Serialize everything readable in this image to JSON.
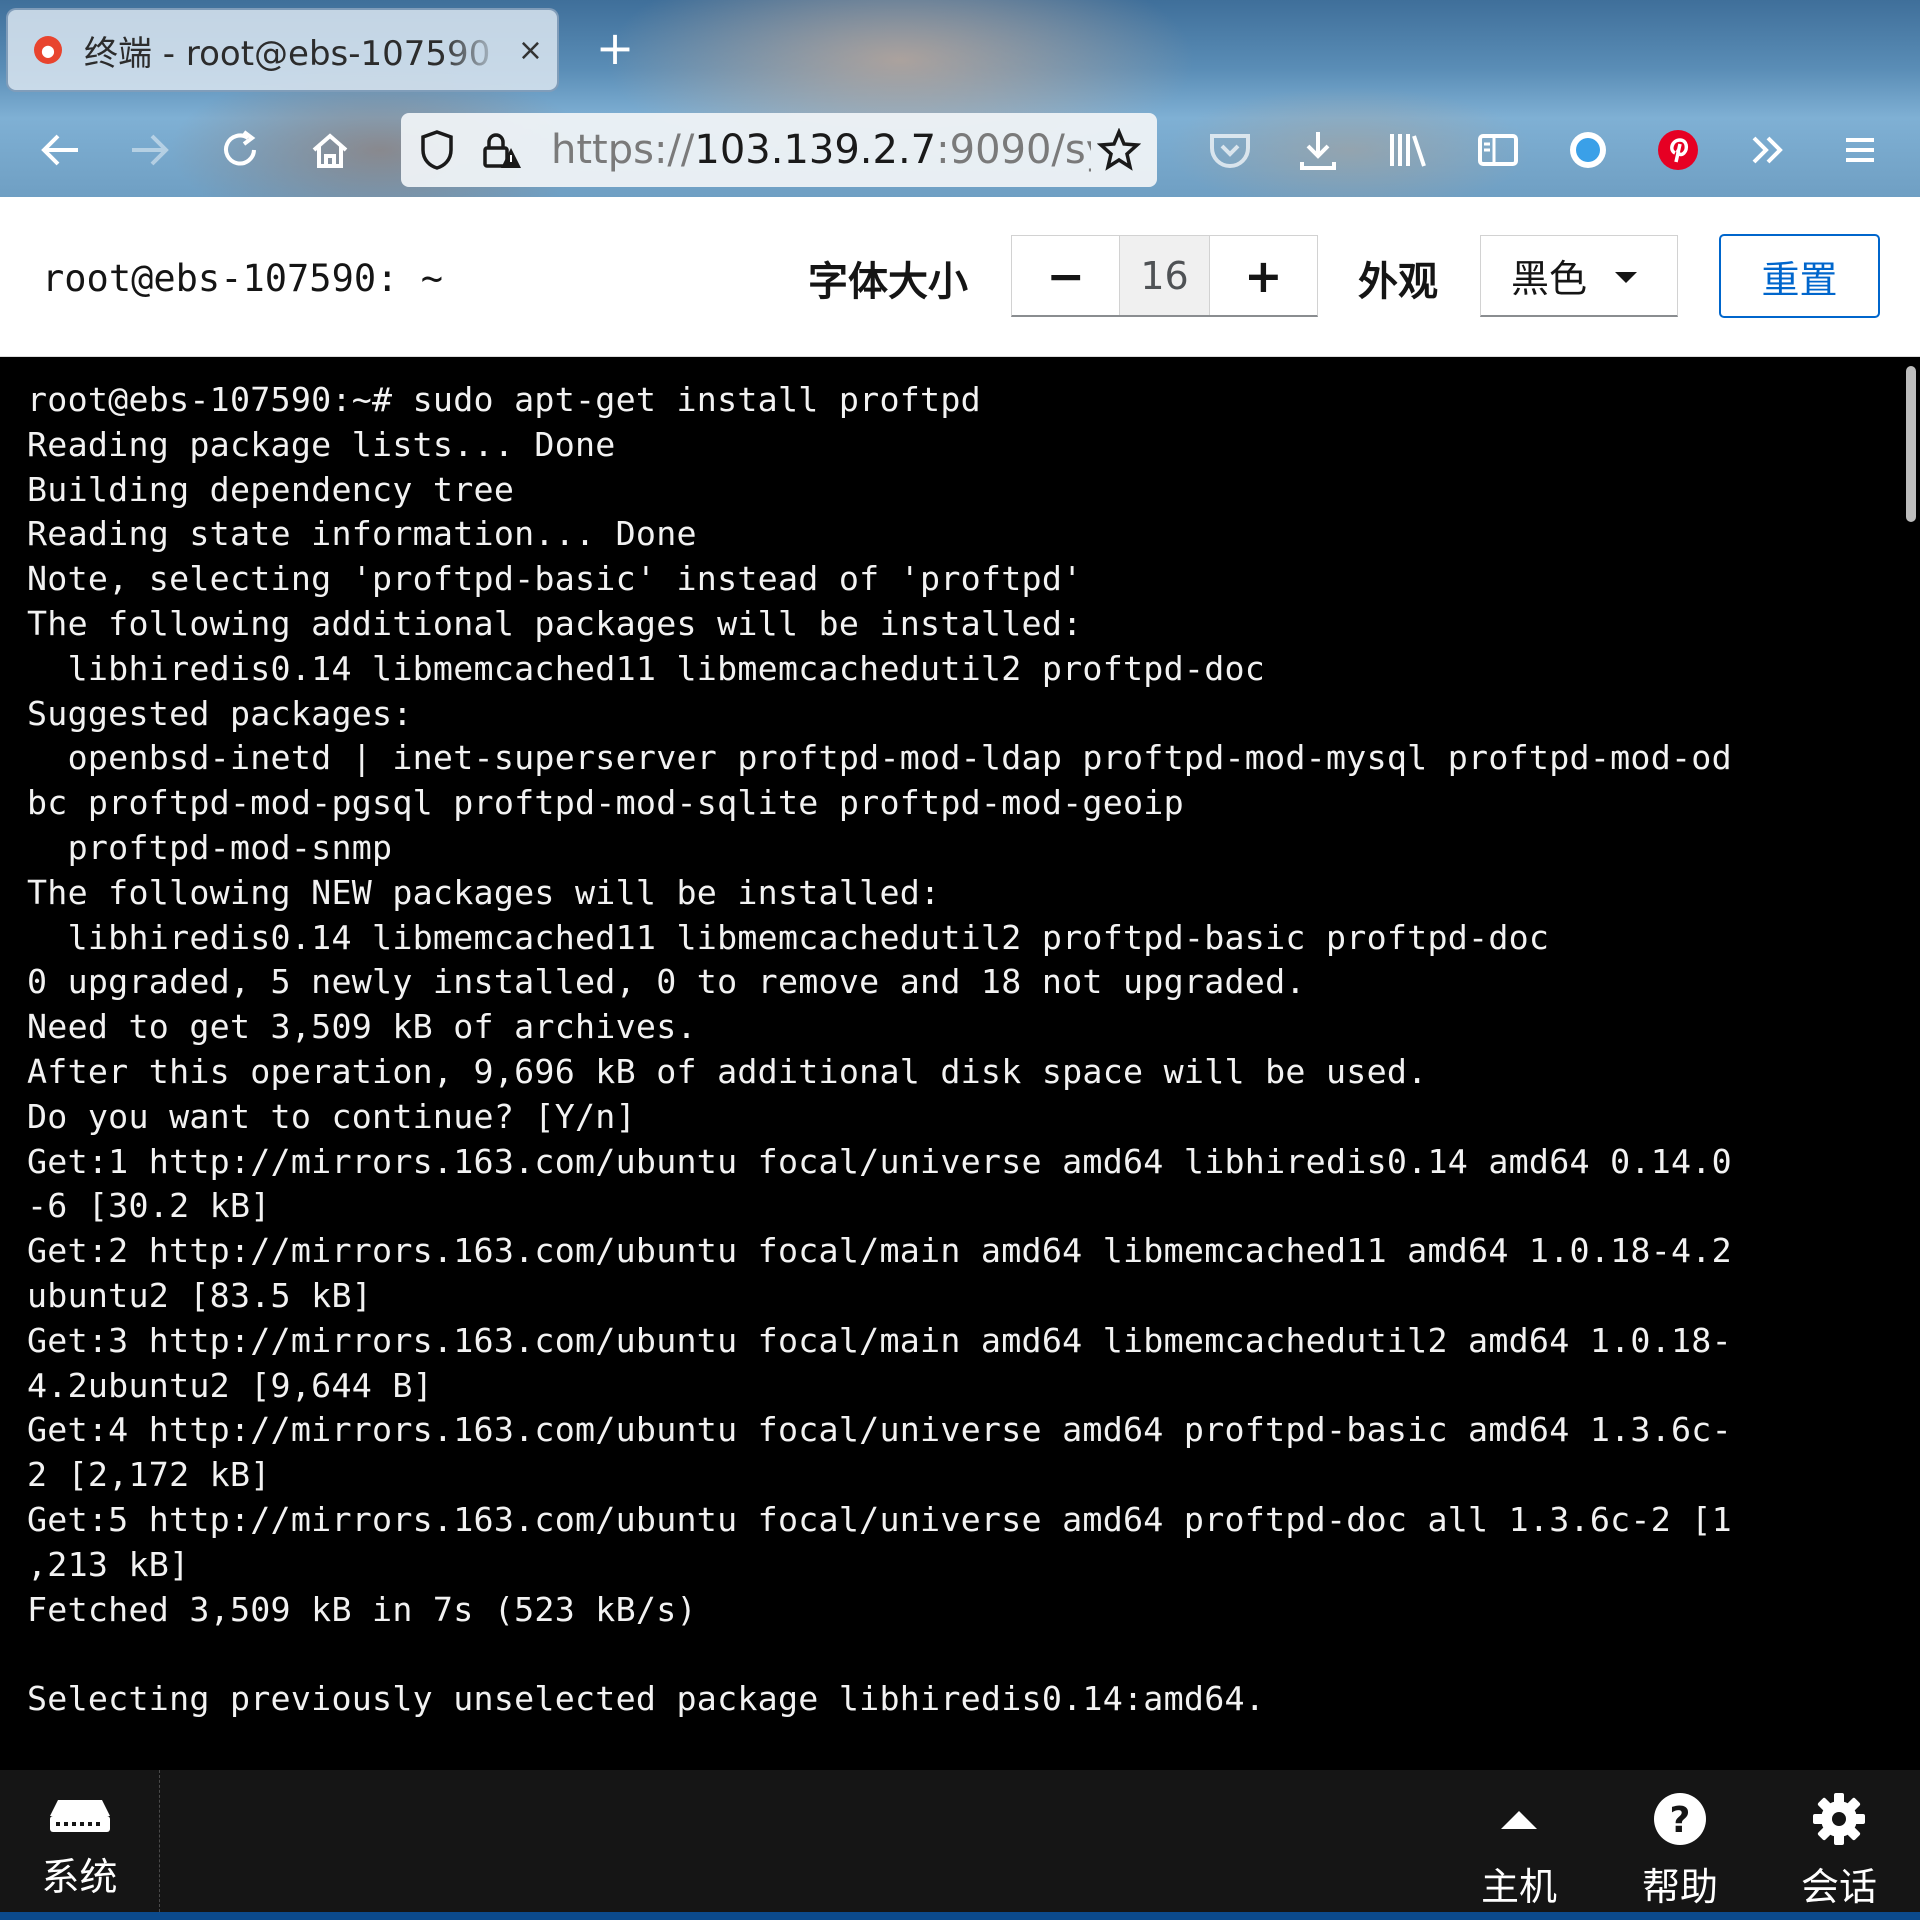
{
  "browser": {
    "tab_title": "终端 - root@ebs-107590",
    "tab_close": "×",
    "new_tab": "+",
    "url_scheme": "https://",
    "url_host": "103.139.2.7",
    "url_rest": ":9090/sy"
  },
  "terminal_header": {
    "host": "root@ebs-107590: ~",
    "font_size_label": "字体大小",
    "decrease": "−",
    "font_size_value": "16",
    "increase": "+",
    "appearance_label": "外观",
    "appearance_value": "黑色",
    "reset_label": "重置"
  },
  "terminal": {
    "lines": [
      "root@ebs-107590:~# sudo apt-get install proftpd",
      "Reading package lists... Done",
      "Building dependency tree",
      "Reading state information... Done",
      "Note, selecting 'proftpd-basic' instead of 'proftpd'",
      "The following additional packages will be installed:",
      "  libhiredis0.14 libmemcached11 libmemcachedutil2 proftpd-doc",
      "Suggested packages:",
      "  openbsd-inetd | inet-superserver proftpd-mod-ldap proftpd-mod-mysql proftpd-mod-od",
      "bc proftpd-mod-pgsql proftpd-mod-sqlite proftpd-mod-geoip",
      "  proftpd-mod-snmp",
      "The following NEW packages will be installed:",
      "  libhiredis0.14 libmemcached11 libmemcachedutil2 proftpd-basic proftpd-doc",
      "0 upgraded, 5 newly installed, 0 to remove and 18 not upgraded.",
      "Need to get 3,509 kB of archives.",
      "After this operation, 9,696 kB of additional disk space will be used.",
      "Do you want to continue? [Y/n]",
      "Get:1 http://mirrors.163.com/ubuntu focal/universe amd64 libhiredis0.14 amd64 0.14.0",
      "-6 [30.2 kB]",
      "Get:2 http://mirrors.163.com/ubuntu focal/main amd64 libmemcached11 amd64 1.0.18-4.2",
      "ubuntu2 [83.5 kB]",
      "Get:3 http://mirrors.163.com/ubuntu focal/main amd64 libmemcachedutil2 amd64 1.0.18-",
      "4.2ubuntu2 [9,644 B]",
      "Get:4 http://mirrors.163.com/ubuntu focal/universe amd64 proftpd-basic amd64 1.3.6c-",
      "2 [2,172 kB]",
      "Get:5 http://mirrors.163.com/ubuntu focal/universe amd64 proftpd-doc all 1.3.6c-2 [1",
      ",213 kB]",
      "Fetched 3,509 kB in 7s (523 kB/s)",
      "",
      "Selecting previously unselected package libhiredis0.14:amd64."
    ]
  },
  "bottom_nav": {
    "system": "系统",
    "host": "主机",
    "help": "帮助",
    "session": "会话"
  },
  "colors": {
    "accent": "#0066cc",
    "terminal_bg": "#000000",
    "terminal_fg": "#f2f2f2",
    "nav_bg": "#151515",
    "nav_accent": "#0b4a8c"
  }
}
